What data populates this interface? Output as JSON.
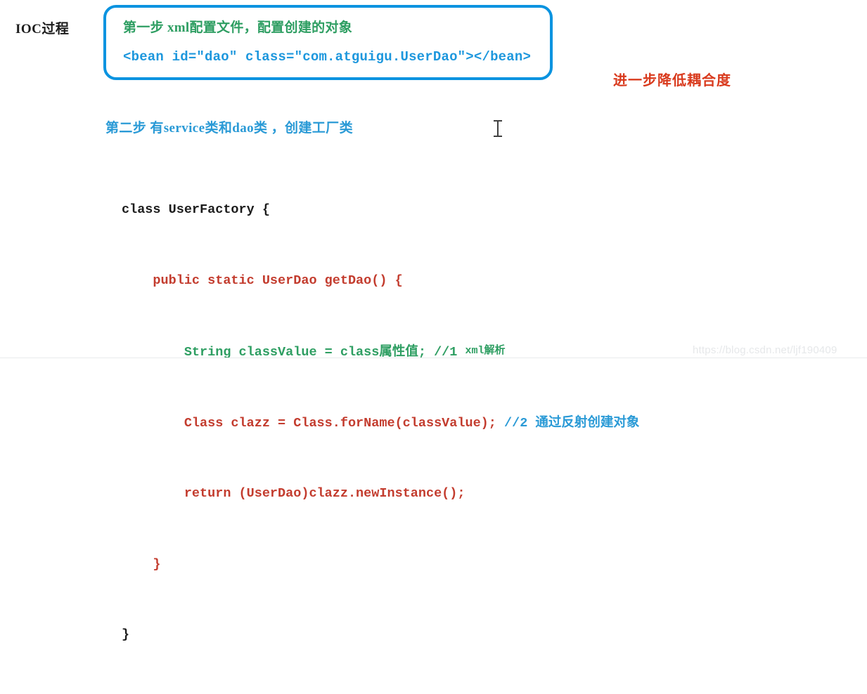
{
  "page": {
    "left_label": "IOC过程",
    "red_note": "进一步降低耦合度",
    "step2_heading": "第二步 有service类和dao类 ，创建工厂类",
    "watermark": "https://blog.csdn.net/ljf190409"
  },
  "step_box": {
    "line1": "第一步 xml配置文件，配置创建的对象",
    "line2": "<bean id=\"dao\" class=\"com.atguigu.UserDao\"></bean>",
    "border_color": "#0a93e0",
    "line1_color": "#2e9e62",
    "line2_color": "#1d97dd"
  },
  "code": {
    "line1": "class UserFactory {",
    "line2": "    public static UserDao getDao() {",
    "line3_a": "        String classValue = class属性值; //1 ",
    "line3_b": "xml解析",
    "line4_a": "        Class clazz = Class.forName(classValue); ",
    "line4_b": "//2 通过反射创建对象",
    "line5": "        return (UserDao)clazz.newInstance();",
    "line6": "    }",
    "line7": "}"
  },
  "colors": {
    "black": "#1c1c1c",
    "red": "#c33c2e",
    "green": "#2e9e62",
    "blue": "#2a9ad6",
    "accent_red": "#d93a1d",
    "watermark": "#e6e8ea"
  }
}
